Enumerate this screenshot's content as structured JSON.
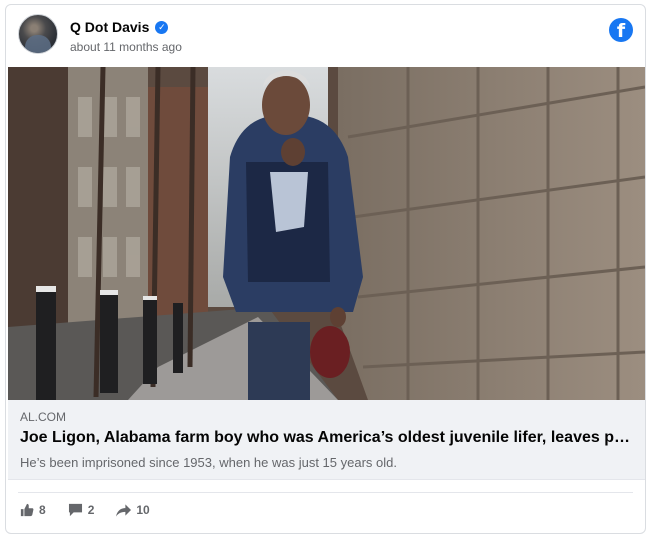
{
  "post": {
    "author": "Q Dot Davis",
    "verified": true,
    "timestamp": "about 11 months ago",
    "brand_icon": "facebook-icon"
  },
  "link": {
    "domain": "AL.COM",
    "title": "Joe Ligon, Alabama farm boy who was America’s oldest juvenile lifer, leaves p…",
    "description": "He’s been imprisoned since 1953, when he was just 15 years old."
  },
  "stats": {
    "likes": "8",
    "comments": "2",
    "shares": "10"
  },
  "colors": {
    "accent": "#1877f2",
    "muted_text": "#65676b",
    "link_bg": "#f0f2f5"
  }
}
